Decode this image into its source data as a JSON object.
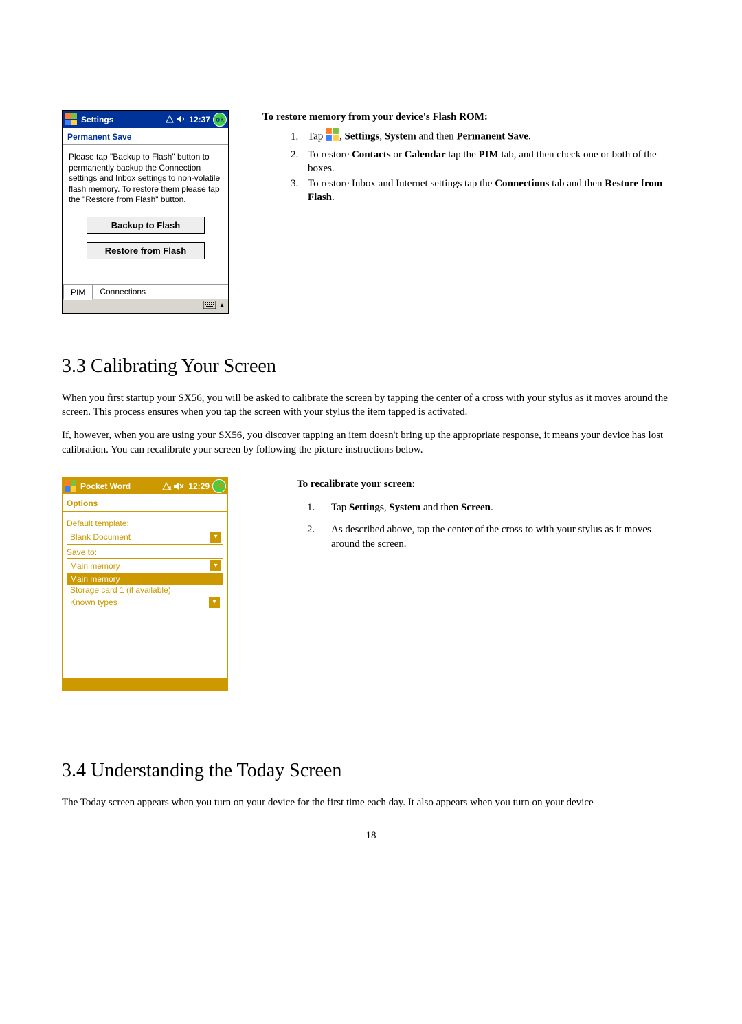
{
  "screenshot1": {
    "titlebar": {
      "title": "Settings",
      "clock": "12:37",
      "ok": "ok"
    },
    "subheader": "Permanent Save",
    "body": "Please tap \"Backup to Flash\" button to permanently backup the Connection settings and Inbox settings to non-volatile flash memory. To restore them please tap the \"Restore from Flash\" button.",
    "button_backup": "Backup to Flash",
    "button_restore": "Restore from Flash",
    "tab_pim": "PIM",
    "tab_connections": "Connections"
  },
  "restore_instructions": {
    "heading": "To restore memory from your device's Flash ROM:",
    "step1_a": "Tap",
    "step1_b": ", ",
    "step1_c": "Settings",
    "step1_d": ", ",
    "step1_e": "System",
    "step1_f": " and then ",
    "step1_g": "Permanent Save",
    "step1_h": ".",
    "step2_a": "To restore ",
    "step2_b": "Contacts",
    "step2_c": " or ",
    "step2_d": "Calendar",
    "step2_e": " tap the ",
    "step2_f": "PIM",
    "step2_g": " tab, and then check one or both of the boxes.",
    "step3_a": "To restore Inbox and Internet settings tap the ",
    "step3_b": "Connections",
    "step3_c": " tab and then ",
    "step3_d": "Restore from Flash",
    "step3_e": "."
  },
  "section33": {
    "heading": "3.3 Calibrating Your Screen",
    "p1": "When you first startup your SX56, you will be asked to calibrate the screen by tapping the center of a cross with your stylus as it moves around the screen. This process ensures when you tap the screen with your stylus the item tapped is activated.",
    "p2": "If, however, when you are using your SX56, you discover tapping an item doesn't bring up the appropriate response, it means your device has lost calibration.  You can recalibrate your screen by following the picture instructions below."
  },
  "screenshot2": {
    "titlebar": {
      "title": "Pocket Word",
      "clock": "12:29",
      "ok": "ok"
    },
    "subheader": "Options",
    "label_template": "Default template:",
    "combo_template": "Blank Document",
    "label_saveto": "Save to:",
    "combo_saveto": "Main memory",
    "dropdown_opt_sel": "Main memory",
    "dropdown_opt_2": "Storage card 1 (if available)",
    "dropdown_opt_3": "Known types"
  },
  "recal_instructions": {
    "heading": "To recalibrate your screen:",
    "step1_a": "Tap ",
    "step1_b": "Settings",
    "step1_c": ", ",
    "step1_d": "System",
    "step1_e": " and then ",
    "step1_f": "Screen",
    "step1_g": ".",
    "step2": "As described above, tap the center of the cross to with your stylus as it moves around the screen."
  },
  "section34": {
    "heading": "3.4 Understanding the Today Screen",
    "p1": "The Today screen appears when you turn on your device for the first time each day.  It also appears when you turn on your device"
  },
  "page_number": "18"
}
